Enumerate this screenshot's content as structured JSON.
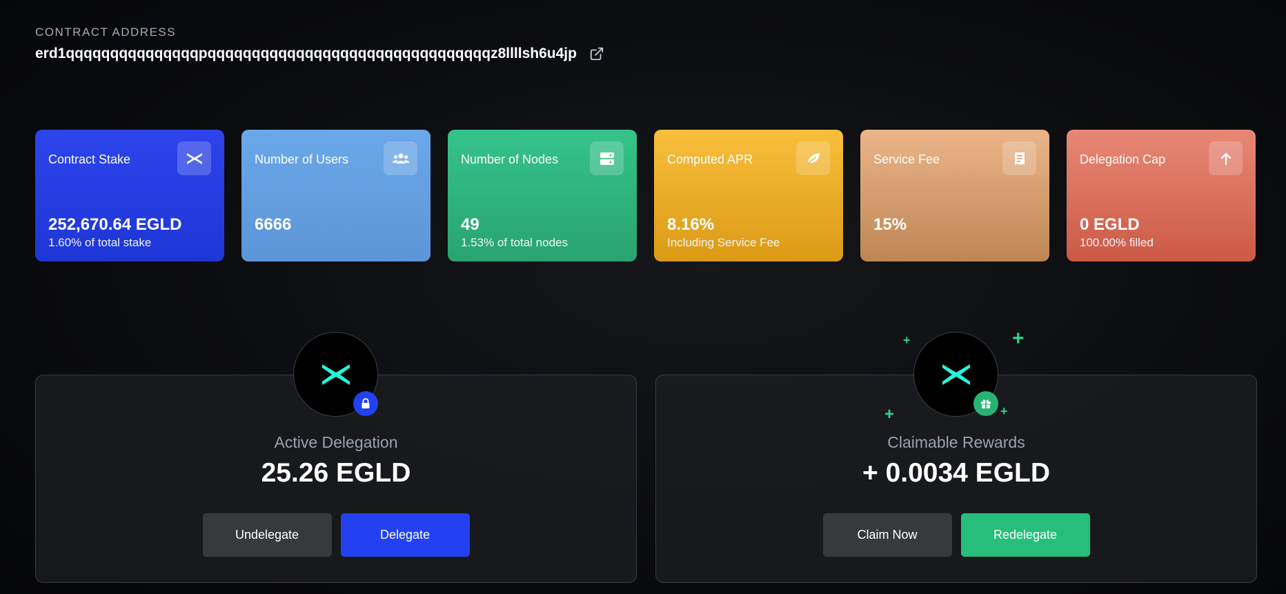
{
  "contract": {
    "label": "CONTRACT ADDRESS",
    "address": "erd1qqqqqqqqqqqqqqqpqqqqqqqqqqqqqqqqqqqqqqqqqqqqqqqqz8llllsh6u4jp",
    "link_icon": "external-link-icon"
  },
  "cards": [
    {
      "title": "Contract Stake",
      "value": "252,670.64 EGLD",
      "sub": "1.60% of total stake",
      "icon": "multiversx-icon",
      "color": "#2640e8"
    },
    {
      "title": "Number of Users",
      "value": "6666",
      "sub": "",
      "icon": "users-icon",
      "color": "#64a0e4"
    },
    {
      "title": "Number of Nodes",
      "value": "49",
      "sub": "1.53% of total nodes",
      "icon": "server-icon",
      "color": "#30b77f"
    },
    {
      "title": "Computed APR",
      "value": "8.16%",
      "sub": "Including Service Fee",
      "icon": "leaf-icon",
      "color": "#eeae28"
    },
    {
      "title": "Service Fee",
      "value": "15%",
      "sub": "",
      "icon": "receipt-icon",
      "color": "#d79e6d"
    },
    {
      "title": "Delegation Cap",
      "value": "0 EGLD",
      "sub": "100.00% filled",
      "icon": "arrow-up-icon",
      "color": "#dc715d"
    }
  ],
  "delegation": {
    "title": "Active Delegation",
    "value": "25.26 EGLD",
    "undelegate_label": "Undelegate",
    "delegate_label": "Delegate",
    "badge_icon": "lock-icon"
  },
  "rewards": {
    "title": "Claimable Rewards",
    "value": "+ 0.0034 EGLD",
    "claim_label": "Claim Now",
    "redelegate_label": "Redelegate",
    "badge_icon": "gift-icon"
  },
  "colors": {
    "accent_blue": "#2341f0",
    "accent_green": "#27be7c",
    "logo_teal": "#23f7dd",
    "button_gray": "#38393d"
  }
}
